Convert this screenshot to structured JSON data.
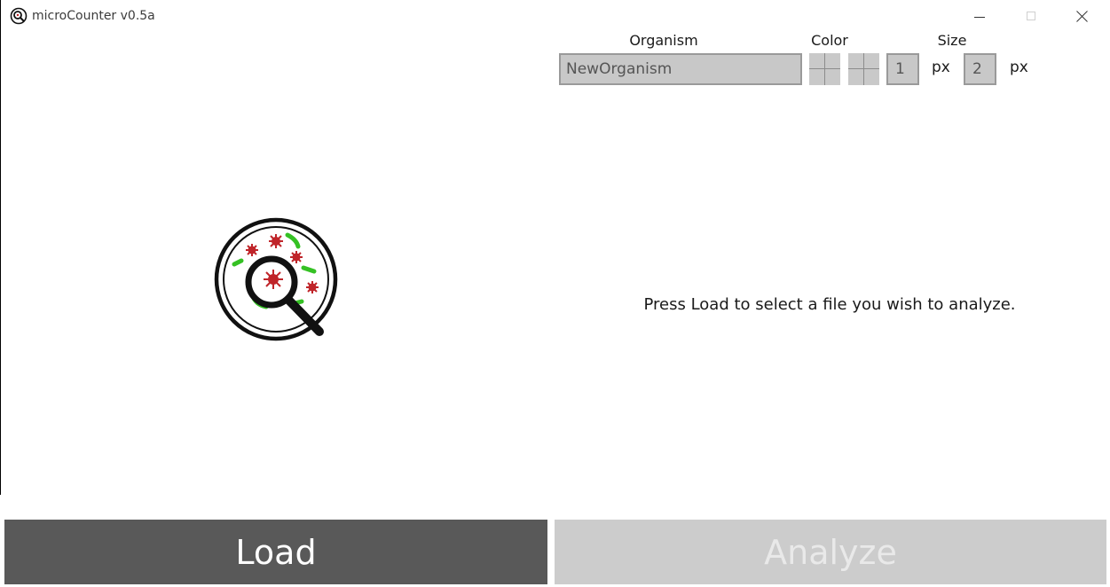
{
  "window": {
    "title": "microCounter v0.5a",
    "icon": "app-logo-icon"
  },
  "controls": {
    "organism_label": "Organism",
    "color_label": "Color",
    "size_label": "Size",
    "organism_value": "NewOrganism",
    "size_min": "1",
    "size_max": "2",
    "unit_label": "px"
  },
  "main": {
    "status_text": "Press Load to select a file you wish to analyze."
  },
  "buttons": {
    "load_label": "Load",
    "analyze_label": "Analyze"
  },
  "colors": {
    "load_bg": "#595959",
    "analyze_bg": "#cccccc",
    "field_bg": "#c8c8c8",
    "bacteria_green": "#35c124",
    "virus_red": "#c0252a"
  }
}
